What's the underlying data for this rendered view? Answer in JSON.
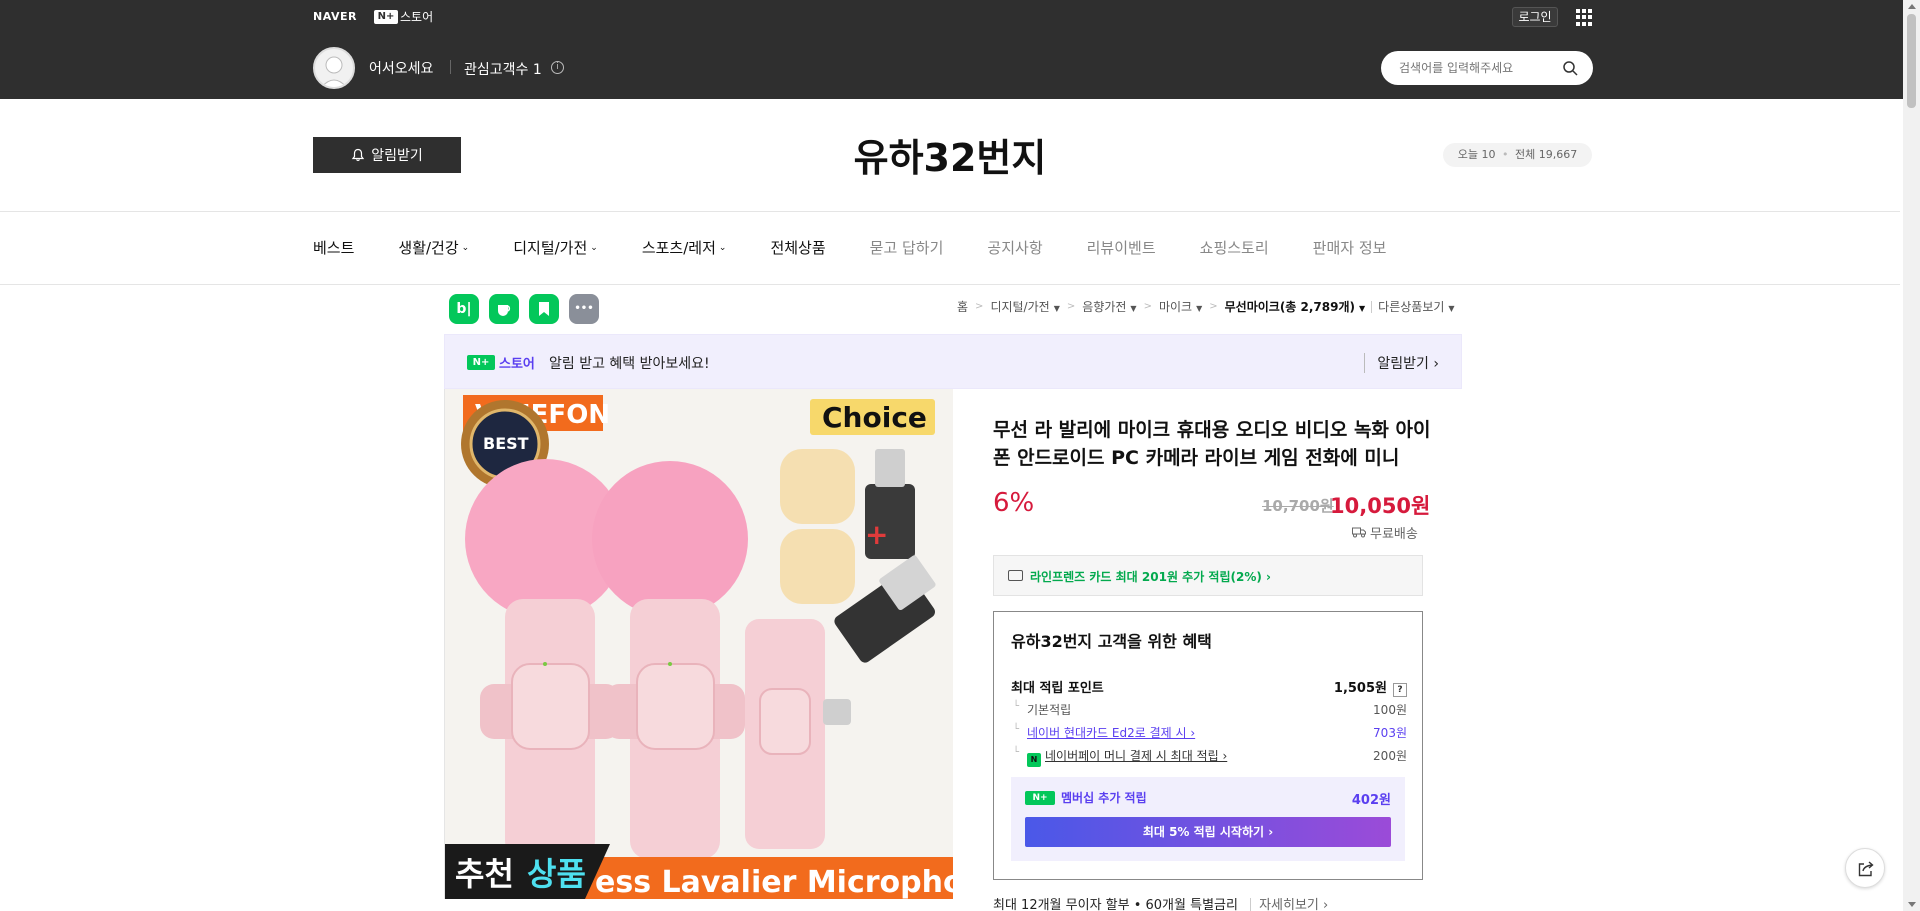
{
  "topbar": {
    "naver_logo": "NAVER",
    "nplus_box": "N+",
    "nplus_label": "스토어",
    "login_label": "로그인",
    "welcome": "어서오세요",
    "interest": "관심고객수 1",
    "search_placeholder": "검색어를 입력해주세요"
  },
  "store": {
    "alarm_label": "알림받기",
    "title": "유하32번지",
    "visit_today": "오늘 10",
    "visit_total": "전체 19,667"
  },
  "nav": [
    {
      "label": "베스트",
      "dropdown": false,
      "muted": false
    },
    {
      "label": "생활/건강",
      "dropdown": true,
      "muted": false
    },
    {
      "label": "디지털/가전",
      "dropdown": true,
      "muted": false
    },
    {
      "label": "스포츠/레저",
      "dropdown": true,
      "muted": false
    },
    {
      "label": "전체상품",
      "dropdown": false,
      "muted": false
    },
    {
      "label": "묻고 답하기",
      "dropdown": false,
      "muted": true
    },
    {
      "label": "공지사항",
      "dropdown": false,
      "muted": true
    },
    {
      "label": "리뷰이벤트",
      "dropdown": false,
      "muted": true
    },
    {
      "label": "쇼핑스토리",
      "dropdown": false,
      "muted": true
    },
    {
      "label": "판매자 정보",
      "dropdown": false,
      "muted": true
    }
  ],
  "sns_icons": [
    "blog-icon",
    "cafe-icon",
    "bookmark-icon",
    "more-icon"
  ],
  "sns_glyphs": {
    "blog": "b|",
    "more": "•••"
  },
  "breadcrumb": {
    "home": "홈",
    "items": [
      "디지털/가전",
      "음향가전",
      "마이크"
    ],
    "current": "무선마이크(총 2,789개)",
    "other": "다른상품보기"
  },
  "promo": {
    "logo_box": "N+",
    "logo_label": "스토어",
    "message": "알림 받고 혜택 받아보세요!",
    "link": "알림받기 ›"
  },
  "product": {
    "image_texts": {
      "brand": "VIMEFON",
      "best": "BEST",
      "choice": "Choice",
      "recommend_1": "추천",
      "recommend_2": "상품",
      "bottom_banner": "ess Lavalier Microphone"
    },
    "title": "무선 라 발리에 마이크 휴대용 오디오 비디오 녹화 아이폰 안드로이드 PC 카메라 라이브 게임 전화에 미니",
    "discount": "6%",
    "original_price": "10,700원",
    "sale_price": "10,050원",
    "shipping": "무료배송",
    "card_benefit": "라인프렌즈 카드 최대 201원 추가 적립(2%) ›",
    "benefit": {
      "heading": "유하32번지 고객을 위한 혜택",
      "max_points_label": "최대 적립 포인트",
      "max_points_value": "1,505원",
      "question_mark": "?",
      "basic_label": "기본적립",
      "basic_value": "100원",
      "hyundai_label": "네이버 현대카드 Ed2로 결제 시 ›",
      "hyundai_value": "703원",
      "npay_badge": "N",
      "npay_label": "네이버페이 머니 결제 시 최대 적립 ›",
      "npay_value": "200원",
      "member_badge": "N+",
      "member_label": "멤버십 추가 적립",
      "member_value": "402원",
      "member_button": "최대 5% 적립 시작하기 ›"
    },
    "installment": "최대 12개월 무이자 할부 • 60개월 특별금리",
    "installment_more": "자세히보기 ›"
  }
}
